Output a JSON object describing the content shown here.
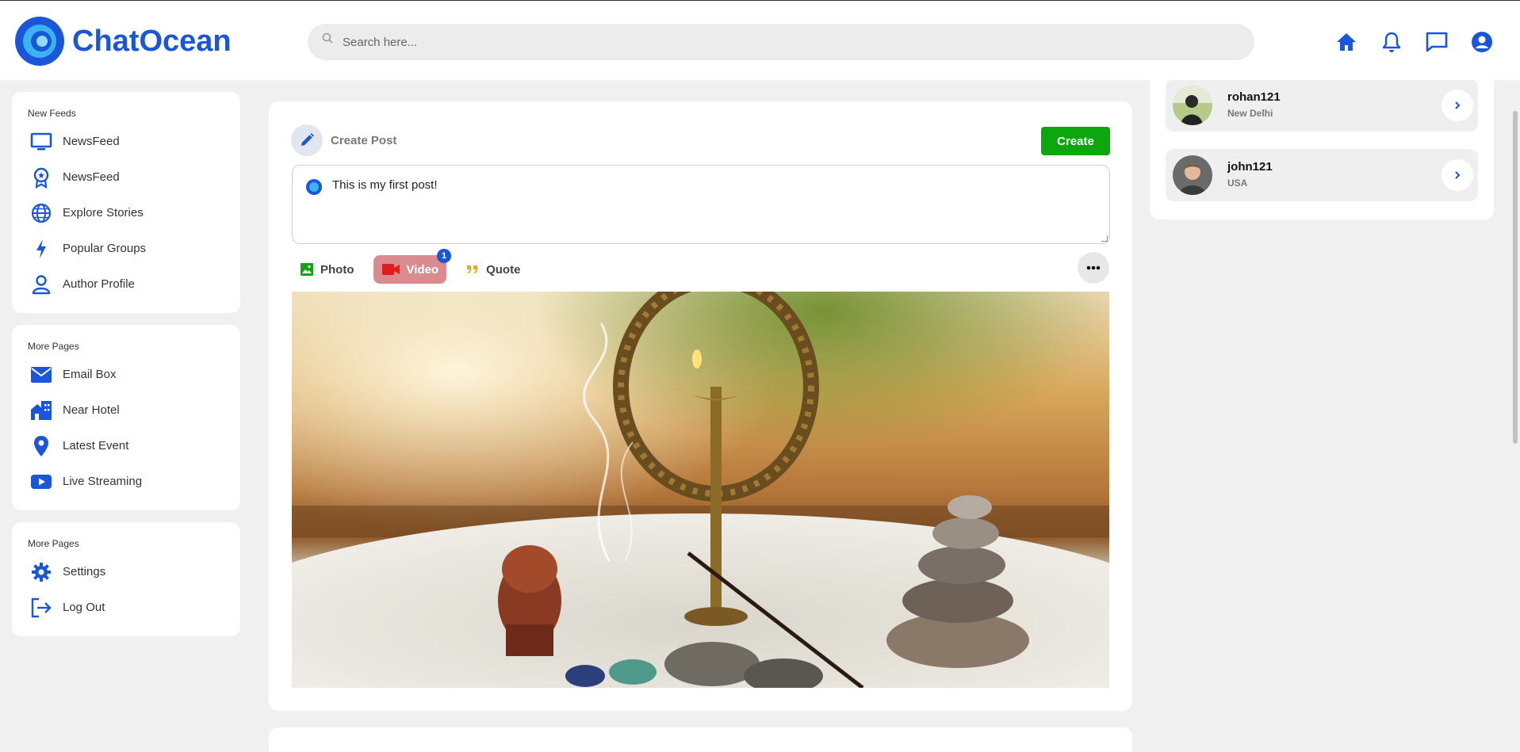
{
  "app": {
    "name": "ChatOcean",
    "accent": "#1a56db"
  },
  "search": {
    "placeholder": "Search here..."
  },
  "header_icons": [
    "home-icon",
    "bell-icon",
    "chat-icon",
    "user-circle-icon"
  ],
  "sidebar": {
    "sections": [
      {
        "title": "New Feeds",
        "items": [
          {
            "label": "NewsFeed",
            "icon": "monitor-icon"
          },
          {
            "label": "NewsFeed",
            "icon": "badge-star-icon"
          },
          {
            "label": "Explore Stories",
            "icon": "globe-icon"
          },
          {
            "label": "Popular Groups",
            "icon": "bolt-icon"
          },
          {
            "label": "Author Profile",
            "icon": "person-icon"
          }
        ]
      },
      {
        "title": "More Pages",
        "items": [
          {
            "label": "Email Box",
            "icon": "envelope-icon"
          },
          {
            "label": "Near Hotel",
            "icon": "hotel-icon"
          },
          {
            "label": "Latest Event",
            "icon": "map-pin-icon"
          },
          {
            "label": "Live Streaming",
            "icon": "youtube-icon"
          }
        ]
      },
      {
        "title": "More Pages",
        "items": [
          {
            "label": "Settings",
            "icon": "gear-icon"
          },
          {
            "label": "Log Out",
            "icon": "logout-icon"
          }
        ]
      }
    ]
  },
  "create_post": {
    "label": "Create Post",
    "button": "Create",
    "text": "This is my first post!",
    "actions": {
      "photo": "Photo",
      "video": "Video",
      "quote": "Quote",
      "video_badge": "1"
    },
    "colors": {
      "create_button": "#0ca70c",
      "video_active": "#d98b8e"
    }
  },
  "friends": [
    {
      "name": "rohan121",
      "location": "New Delhi"
    },
    {
      "name": "john121",
      "location": "USA"
    }
  ]
}
